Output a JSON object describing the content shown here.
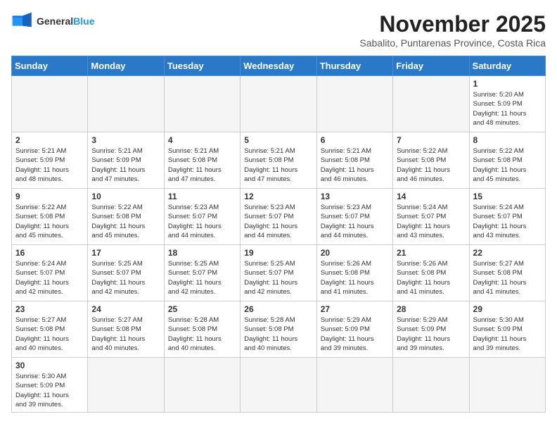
{
  "header": {
    "logo_general": "General",
    "logo_blue": "Blue",
    "month_title": "November 2025",
    "location": "Sabalito, Puntarenas Province, Costa Rica"
  },
  "weekdays": [
    "Sunday",
    "Monday",
    "Tuesday",
    "Wednesday",
    "Thursday",
    "Friday",
    "Saturday"
  ],
  "weeks": [
    [
      {
        "day": "",
        "info": ""
      },
      {
        "day": "",
        "info": ""
      },
      {
        "day": "",
        "info": ""
      },
      {
        "day": "",
        "info": ""
      },
      {
        "day": "",
        "info": ""
      },
      {
        "day": "",
        "info": ""
      },
      {
        "day": "1",
        "info": "Sunrise: 5:20 AM\nSunset: 5:09 PM\nDaylight: 11 hours\nand 48 minutes."
      }
    ],
    [
      {
        "day": "2",
        "info": "Sunrise: 5:21 AM\nSunset: 5:09 PM\nDaylight: 11 hours\nand 48 minutes."
      },
      {
        "day": "3",
        "info": "Sunrise: 5:21 AM\nSunset: 5:09 PM\nDaylight: 11 hours\nand 47 minutes."
      },
      {
        "day": "4",
        "info": "Sunrise: 5:21 AM\nSunset: 5:08 PM\nDaylight: 11 hours\nand 47 minutes."
      },
      {
        "day": "5",
        "info": "Sunrise: 5:21 AM\nSunset: 5:08 PM\nDaylight: 11 hours\nand 47 minutes."
      },
      {
        "day": "6",
        "info": "Sunrise: 5:21 AM\nSunset: 5:08 PM\nDaylight: 11 hours\nand 46 minutes."
      },
      {
        "day": "7",
        "info": "Sunrise: 5:22 AM\nSunset: 5:08 PM\nDaylight: 11 hours\nand 46 minutes."
      },
      {
        "day": "8",
        "info": "Sunrise: 5:22 AM\nSunset: 5:08 PM\nDaylight: 11 hours\nand 45 minutes."
      }
    ],
    [
      {
        "day": "9",
        "info": "Sunrise: 5:22 AM\nSunset: 5:08 PM\nDaylight: 11 hours\nand 45 minutes."
      },
      {
        "day": "10",
        "info": "Sunrise: 5:22 AM\nSunset: 5:08 PM\nDaylight: 11 hours\nand 45 minutes."
      },
      {
        "day": "11",
        "info": "Sunrise: 5:23 AM\nSunset: 5:07 PM\nDaylight: 11 hours\nand 44 minutes."
      },
      {
        "day": "12",
        "info": "Sunrise: 5:23 AM\nSunset: 5:07 PM\nDaylight: 11 hours\nand 44 minutes."
      },
      {
        "day": "13",
        "info": "Sunrise: 5:23 AM\nSunset: 5:07 PM\nDaylight: 11 hours\nand 44 minutes."
      },
      {
        "day": "14",
        "info": "Sunrise: 5:24 AM\nSunset: 5:07 PM\nDaylight: 11 hours\nand 43 minutes."
      },
      {
        "day": "15",
        "info": "Sunrise: 5:24 AM\nSunset: 5:07 PM\nDaylight: 11 hours\nand 43 minutes."
      }
    ],
    [
      {
        "day": "16",
        "info": "Sunrise: 5:24 AM\nSunset: 5:07 PM\nDaylight: 11 hours\nand 42 minutes."
      },
      {
        "day": "17",
        "info": "Sunrise: 5:25 AM\nSunset: 5:07 PM\nDaylight: 11 hours\nand 42 minutes."
      },
      {
        "day": "18",
        "info": "Sunrise: 5:25 AM\nSunset: 5:07 PM\nDaylight: 11 hours\nand 42 minutes."
      },
      {
        "day": "19",
        "info": "Sunrise: 5:25 AM\nSunset: 5:07 PM\nDaylight: 11 hours\nand 42 minutes."
      },
      {
        "day": "20",
        "info": "Sunrise: 5:26 AM\nSunset: 5:08 PM\nDaylight: 11 hours\nand 41 minutes."
      },
      {
        "day": "21",
        "info": "Sunrise: 5:26 AM\nSunset: 5:08 PM\nDaylight: 11 hours\nand 41 minutes."
      },
      {
        "day": "22",
        "info": "Sunrise: 5:27 AM\nSunset: 5:08 PM\nDaylight: 11 hours\nand 41 minutes."
      }
    ],
    [
      {
        "day": "23",
        "info": "Sunrise: 5:27 AM\nSunset: 5:08 PM\nDaylight: 11 hours\nand 40 minutes."
      },
      {
        "day": "24",
        "info": "Sunrise: 5:27 AM\nSunset: 5:08 PM\nDaylight: 11 hours\nand 40 minutes."
      },
      {
        "day": "25",
        "info": "Sunrise: 5:28 AM\nSunset: 5:08 PM\nDaylight: 11 hours\nand 40 minutes."
      },
      {
        "day": "26",
        "info": "Sunrise: 5:28 AM\nSunset: 5:08 PM\nDaylight: 11 hours\nand 40 minutes."
      },
      {
        "day": "27",
        "info": "Sunrise: 5:29 AM\nSunset: 5:09 PM\nDaylight: 11 hours\nand 39 minutes."
      },
      {
        "day": "28",
        "info": "Sunrise: 5:29 AM\nSunset: 5:09 PM\nDaylight: 11 hours\nand 39 minutes."
      },
      {
        "day": "29",
        "info": "Sunrise: 5:30 AM\nSunset: 5:09 PM\nDaylight: 11 hours\nand 39 minutes."
      }
    ],
    [
      {
        "day": "30",
        "info": "Sunrise: 5:30 AM\nSunset: 5:09 PM\nDaylight: 11 hours\nand 39 minutes."
      },
      {
        "day": "",
        "info": ""
      },
      {
        "day": "",
        "info": ""
      },
      {
        "day": "",
        "info": ""
      },
      {
        "day": "",
        "info": ""
      },
      {
        "day": "",
        "info": ""
      },
      {
        "day": "",
        "info": ""
      }
    ]
  ]
}
